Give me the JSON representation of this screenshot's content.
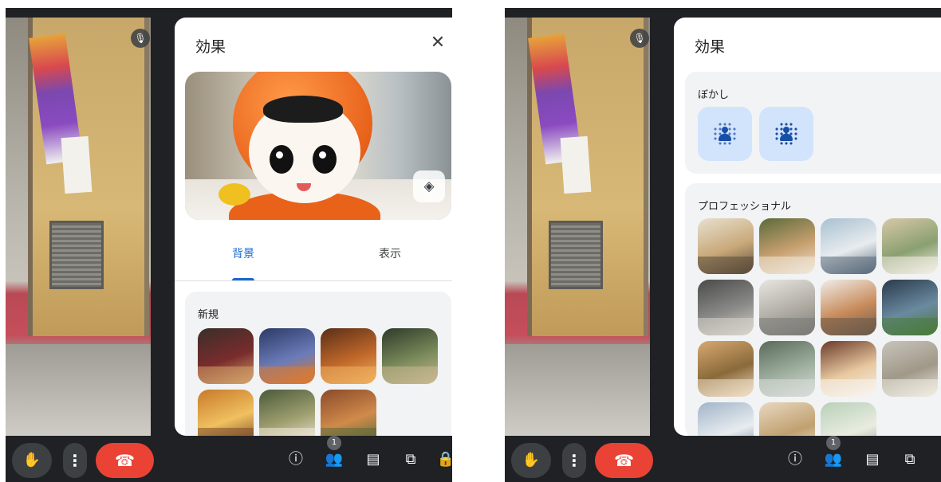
{
  "left": {
    "panel_title": "効果",
    "close_symbol": "✕",
    "tabs": [
      {
        "label": "背景",
        "active": true
      },
      {
        "label": "表示",
        "active": false
      }
    ],
    "section_title": "新規",
    "thumbnails": [
      {
        "name": "gothic-library",
        "colors": [
          "#3a2e2a",
          "#7a2c2c",
          "#d4a26a"
        ]
      },
      {
        "name": "halloween-tree",
        "colors": [
          "#2b3a66",
          "#6b7bb8",
          "#e07a2a"
        ]
      },
      {
        "name": "cozy-bedroom",
        "colors": [
          "#5a2e18",
          "#c0682a",
          "#f0b060"
        ]
      },
      {
        "name": "greenhouse",
        "colors": [
          "#2e3a2a",
          "#7a8a5a",
          "#c8b890"
        ]
      },
      {
        "name": "retro-room",
        "colors": [
          "#c87a2a",
          "#f0c060",
          "#7a4a2a"
        ]
      },
      {
        "name": "garden-party",
        "colors": [
          "#4a5a3a",
          "#a0a070",
          "#f0e8d8"
        ]
      },
      {
        "name": "autumn-plaza",
        "colors": [
          "#8a4a2a",
          "#d08a4a",
          "#5a6a3a"
        ]
      }
    ]
  },
  "right": {
    "panel_title": "効果",
    "close_symbol": "✕",
    "blur_section_title": "ぼかし",
    "blur_options": [
      "slight-blur",
      "full-blur"
    ],
    "pro_section_title": "プロフェッショナル",
    "thumbnails": [
      {
        "name": "bookshelf-room",
        "colors": [
          "#e8e0d0",
          "#c8a878",
          "#5a4a3a"
        ]
      },
      {
        "name": "plant-corner",
        "colors": [
          "#5a6a3a",
          "#c8a070",
          "#f0e8d8"
        ]
      },
      {
        "name": "glass-office",
        "colors": [
          "#a8c0d0",
          "#e8ecef",
          "#5a6a7a"
        ]
      },
      {
        "name": "living-room",
        "colors": [
          "#d8c8a8",
          "#8aa070",
          "#f4efe6"
        ]
      },
      {
        "name": "library-chair",
        "colors": [
          "#4a4a48",
          "#8a8a88",
          "#d8d4cc"
        ]
      },
      {
        "name": "white-studio",
        "colors": [
          "#e8e6e0",
          "#b0aca4",
          "#7a7a76"
        ]
      },
      {
        "name": "home-office",
        "colors": [
          "#f0ede8",
          "#c88a5a",
          "#6a5a4a"
        ]
      },
      {
        "name": "dark-window",
        "colors": [
          "#2a3a4a",
          "#6a8aa0",
          "#4a7a3a"
        ]
      },
      {
        "name": "lounge-sofa",
        "colors": [
          "#d8a870",
          "#8a6a3a",
          "#f0e0c8"
        ]
      },
      {
        "name": "courtyard-tree",
        "colors": [
          "#5a6a5a",
          "#a0b0a0",
          "#d8dcd8"
        ]
      },
      {
        "name": "brick-kitchen",
        "colors": [
          "#6a3a2a",
          "#e8c8a0",
          "#f8f4ee"
        ]
      },
      {
        "name": "minimal-shelf",
        "colors": [
          "#c8c4bc",
          "#a09888",
          "#f0ece4"
        ]
      },
      {
        "name": "blue-office",
        "colors": [
          "#a0b4c8",
          "#e8ecf0",
          "#6a7a8a"
        ]
      },
      {
        "name": "warm-hall",
        "colors": [
          "#e8d8c0",
          "#c0a070",
          "#f4f0e8"
        ]
      },
      {
        "name": "mint-room",
        "colors": [
          "#b8d0b8",
          "#e8ece0",
          "#8aa08a"
        ]
      }
    ]
  },
  "callbar": {
    "participant_count": "1",
    "icons": [
      "raise-hand-icon",
      "more-options-icon",
      "end-call-icon",
      "info-icon",
      "people-icon",
      "chat-icon",
      "activities-icon",
      "lock-icon"
    ]
  }
}
